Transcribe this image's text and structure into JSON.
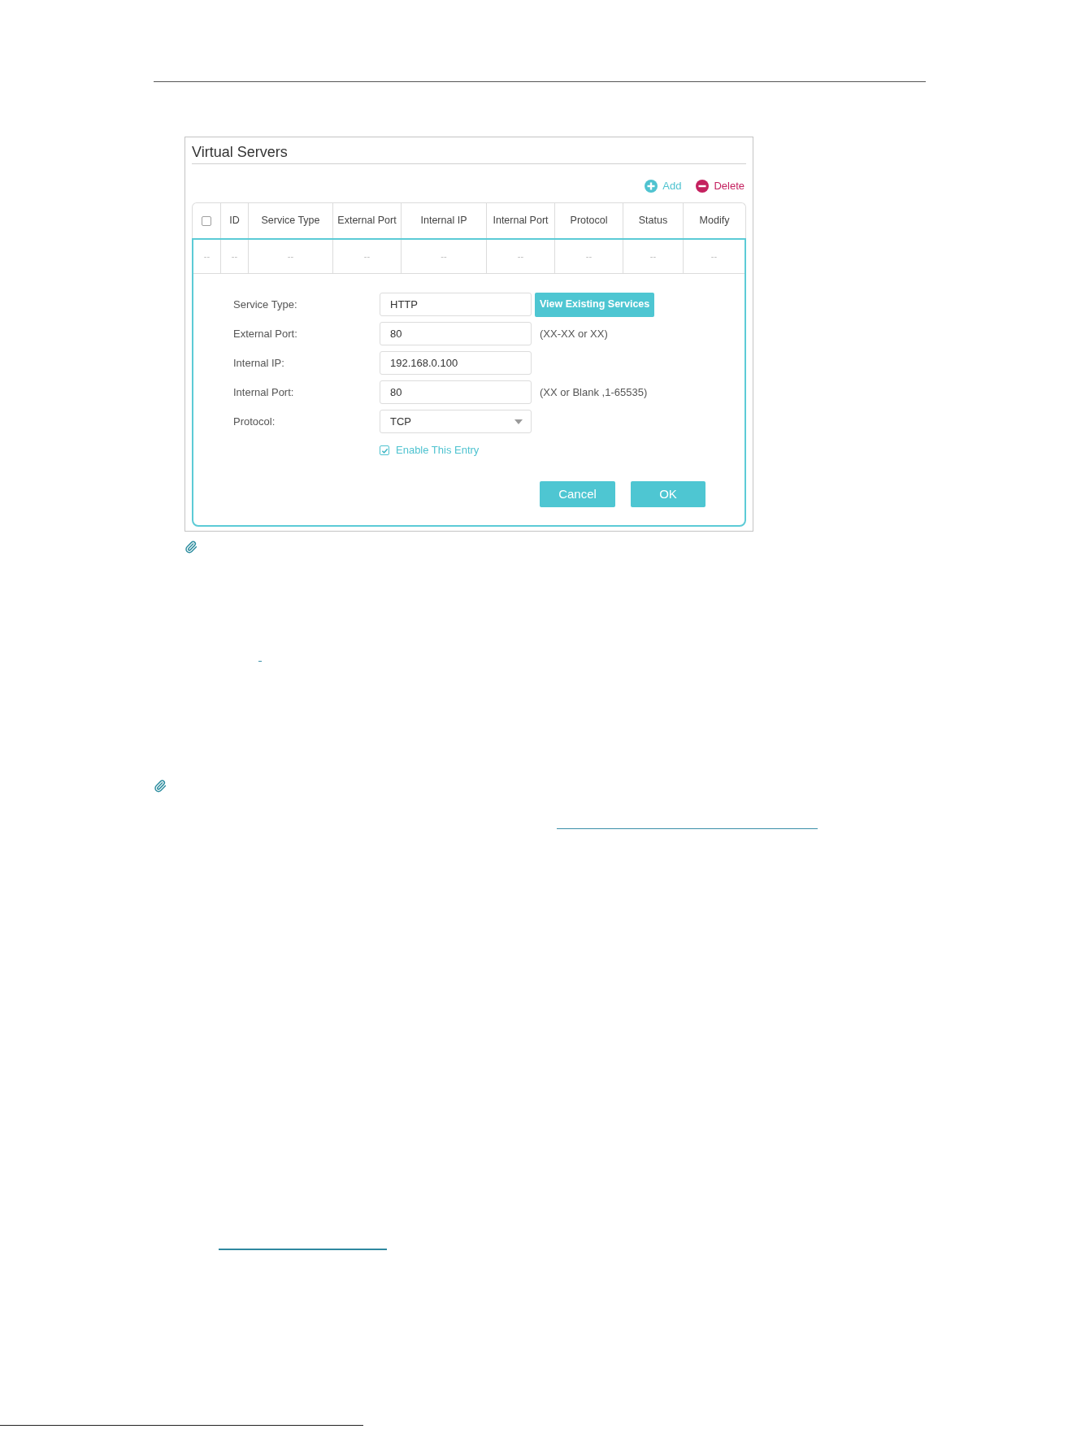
{
  "panel": {
    "title": "Virtual Servers",
    "actions": [
      {
        "kind": "add",
        "label": "Add"
      },
      {
        "kind": "delete",
        "label": "Delete"
      }
    ],
    "table": {
      "select_all": {
        "checked": false
      },
      "columns": [
        "",
        "ID",
        "Service Type",
        "External Port",
        "Internal IP",
        "Internal Port",
        "Protocol",
        "Status",
        "Modify"
      ],
      "rows": [
        {
          "cells": [
            "--",
            "--",
            "--",
            "--",
            "--",
            "--",
            "--",
            "--",
            "--"
          ]
        }
      ]
    },
    "form": {
      "fields": [
        {
          "kind": "text",
          "label": "Service Type:",
          "value": "HTTP",
          "button": "View Existing Services"
        },
        {
          "kind": "text",
          "label": "External Port:",
          "value": "80",
          "hint": "(XX-XX or XX)"
        },
        {
          "kind": "text",
          "label": "Internal IP:",
          "value": "192.168.0.100"
        },
        {
          "kind": "text",
          "label": "Internal Port:",
          "value": "80",
          "hint": "(XX or Blank ,1-65535)"
        },
        {
          "kind": "select",
          "label": "Protocol:",
          "value": "TCP"
        }
      ],
      "enable": {
        "label": "Enable This Entry",
        "checked": true
      },
      "buttons": [
        {
          "kind": "cancel",
          "label": "Cancel"
        },
        {
          "kind": "ok",
          "label": "OK"
        }
      ]
    }
  }
}
